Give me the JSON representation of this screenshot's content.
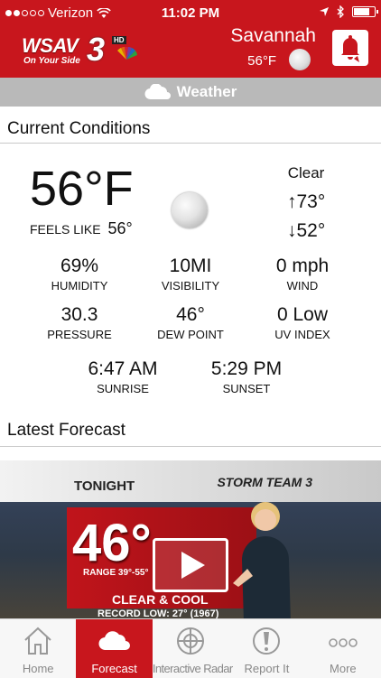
{
  "status_bar": {
    "carrier": "Verizon",
    "time": "11:02 PM",
    "battery_level": 0.7
  },
  "header": {
    "logo_text": "WSAV",
    "logo_number": "3",
    "logo_badge": "HD",
    "logo_slogan": "On Your Side",
    "city": "Savannah",
    "temp": "56°F",
    "moon_icon": "full-moon-icon",
    "alert_icon": "bell-icon"
  },
  "weather_bar": {
    "label": "Weather",
    "icon": "cloud-icon"
  },
  "current": {
    "title": "Current Conditions",
    "temperature": "56°F",
    "feels_like_label": "FEELS LIKE",
    "feels_like_value": "56°",
    "condition": "Clear",
    "high": "↑73°",
    "low": "↓52°",
    "stats": [
      {
        "value": "69%",
        "label": "HUMIDITY"
      },
      {
        "value": "10MI",
        "label": "VISIBILITY"
      },
      {
        "value": "0 mph",
        "label": "WIND"
      },
      {
        "value": "30.3",
        "label": "PRESSURE"
      },
      {
        "value": "46°",
        "label": "DEW POINT"
      },
      {
        "value": "0 Low",
        "label": "UV INDEX"
      }
    ],
    "sunrise": {
      "value": "6:47 AM",
      "label": "SUNRISE"
    },
    "sunset": {
      "value": "5:29 PM",
      "label": "SUNSET"
    }
  },
  "forecast": {
    "title": "Latest Forecast",
    "video": {
      "heading": "TONIGHT",
      "brand": "STORM TEAM 3",
      "temp": "46°",
      "range": "RANGE 39°-55°",
      "condition": "CLEAR & COOL",
      "record": "RECORD LOW: 27° (1967)"
    }
  },
  "tab_bar": {
    "tabs": [
      {
        "label": "Home",
        "icon": "house-icon",
        "active": false
      },
      {
        "label": "Forecast",
        "icon": "cloud-icon",
        "active": true
      },
      {
        "label": "Interactive Radar",
        "icon": "radar-icon",
        "active": false
      },
      {
        "label": "Report It",
        "icon": "exclamation-icon",
        "active": false
      },
      {
        "label": "More",
        "icon": "more-dots-icon",
        "active": false
      }
    ]
  }
}
